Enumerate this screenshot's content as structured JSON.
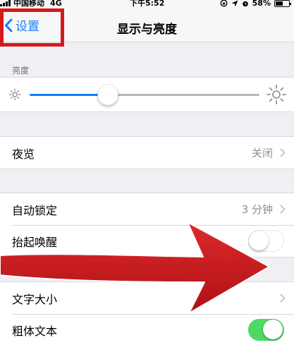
{
  "status_bar": {
    "carrier": "中国移动",
    "network": "4G",
    "time": "下午5:52",
    "battery": "58%",
    "battery_level": 0.58
  },
  "nav": {
    "back_label": "设置",
    "title": "显示与亮度"
  },
  "brightness": {
    "section_header": "亮度",
    "level": 0.34
  },
  "rows": {
    "night_shift": {
      "label": "夜览",
      "value": "关闭"
    },
    "auto_lock": {
      "label": "自动锁定",
      "value": "3 分钟"
    },
    "raise_to_wake": {
      "label": "抬起唤醒",
      "on": false
    },
    "text_size": {
      "label": "文字大小"
    },
    "bold_text": {
      "label": "粗体文本",
      "on": true
    }
  },
  "colors": {
    "accent": "#157efb",
    "toggle_on": "#4cd964",
    "highlight": "#d51a1a",
    "arrow": "#c8161a"
  }
}
